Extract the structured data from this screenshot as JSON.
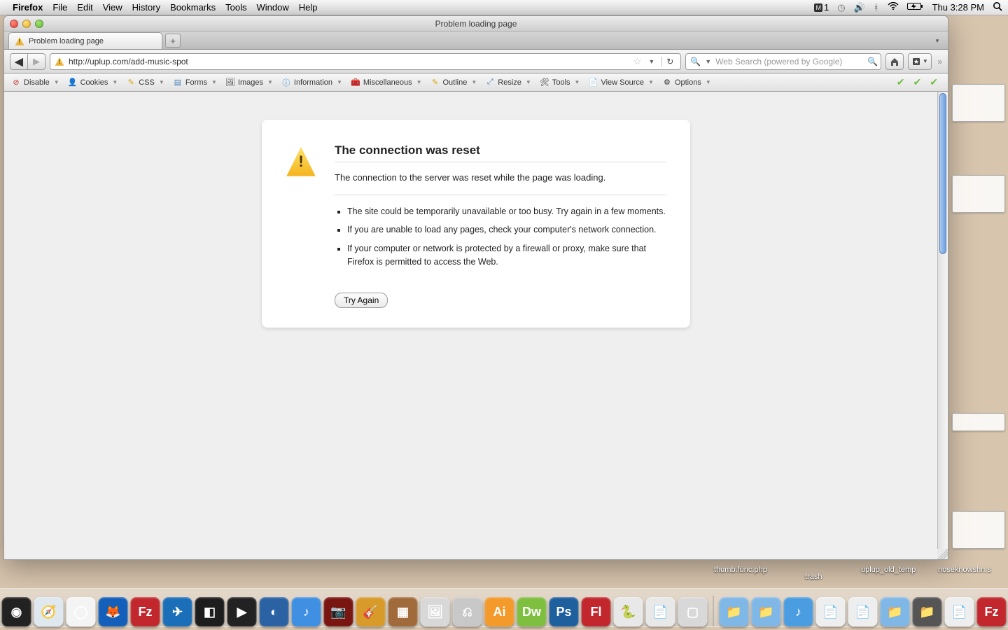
{
  "menubar": {
    "app": "Firefox",
    "items": [
      "File",
      "Edit",
      "View",
      "History",
      "Bookmarks",
      "Tools",
      "Window",
      "Help"
    ],
    "adobe_badge": "1",
    "clock": "Thu 3:28 PM"
  },
  "window": {
    "title": "Problem loading page"
  },
  "tab": {
    "title": "Problem loading page"
  },
  "address": {
    "url": "http://uplup.com/add-music-spot"
  },
  "search": {
    "placeholder": "Web Search (powered by Google)"
  },
  "devtoolbar": {
    "items": [
      "Disable",
      "Cookies",
      "CSS",
      "Forms",
      "Images",
      "Information",
      "Miscellaneous",
      "Outline",
      "Resize",
      "Tools",
      "View Source",
      "Options"
    ]
  },
  "error": {
    "heading": "The connection was reset",
    "message": "The connection to the server was reset while the page was loading.",
    "bullets": [
      "The site could be temporarily unavailable or too busy. Try again in a few moments.",
      "If you are unable to load any pages, check your computer's network connection.",
      "If your computer or network is protected by a firewall or proxy, make sure that Firefox is permitted to access the Web."
    ],
    "button": "Try Again"
  },
  "desktop": {
    "labels": [
      "thumb.func.php",
      "trash",
      "uplup_old_temp",
      "noseknowshn.s"
    ]
  },
  "dock": {
    "apps": [
      {
        "name": "finder",
        "bg": "#3aa3f2",
        "txt": "☺"
      },
      {
        "name": "dashboard",
        "bg": "#222",
        "txt": "◉"
      },
      {
        "name": "safari",
        "bg": "#dfe7ef",
        "txt": "🧭"
      },
      {
        "name": "chrome",
        "bg": "#f4f4f4",
        "txt": "◯"
      },
      {
        "name": "firefox",
        "bg": "#135fb9",
        "txt": "🦊"
      },
      {
        "name": "filezilla",
        "bg": "#c1272d",
        "txt": "Fz"
      },
      {
        "name": "tweetdeck",
        "bg": "#1b6fb8",
        "txt": "✈"
      },
      {
        "name": "app",
        "bg": "#1d1d1d",
        "txt": "◧"
      },
      {
        "name": "quicktime",
        "bg": "#222",
        "txt": "▶"
      },
      {
        "name": "app2",
        "bg": "#2a62a4",
        "txt": "◐"
      },
      {
        "name": "itunes",
        "bg": "#3f8fe2",
        "txt": "♪"
      },
      {
        "name": "photobooth",
        "bg": "#7a1611",
        "txt": "📷"
      },
      {
        "name": "garageband",
        "bg": "#d89b2a",
        "txt": "🎸"
      },
      {
        "name": "app3",
        "bg": "#a06a3a",
        "txt": "▦"
      },
      {
        "name": "preview",
        "bg": "#d8d8d8",
        "txt": "🖼"
      },
      {
        "name": "app4",
        "bg": "#c8c8c8",
        "txt": "⎌"
      },
      {
        "name": "illustrator",
        "bg": "#f39a2b",
        "txt": "Ai"
      },
      {
        "name": "dreamweaver",
        "bg": "#7fbf3f",
        "txt": "Dw"
      },
      {
        "name": "photoshop",
        "bg": "#1e5f9e",
        "txt": "Ps"
      },
      {
        "name": "flash",
        "bg": "#c1272d",
        "txt": "Fl"
      },
      {
        "name": "python",
        "bg": "#e8e8e8",
        "txt": "🐍"
      },
      {
        "name": "textedit",
        "bg": "#e8e8e8",
        "txt": "📄"
      },
      {
        "name": "terminal",
        "bg": "#d8d8d8",
        "txt": "▢"
      }
    ],
    "stacks": [
      {
        "name": "folder1",
        "bg": "#7fb7e6",
        "txt": "📁"
      },
      {
        "name": "folder2",
        "bg": "#7fb7e6",
        "txt": "📁"
      },
      {
        "name": "music",
        "bg": "#4a9de0",
        "txt": "♪"
      },
      {
        "name": "doc1",
        "bg": "#eee",
        "txt": "📄"
      },
      {
        "name": "doc2",
        "bg": "#eee",
        "txt": "📄"
      },
      {
        "name": "folder3",
        "bg": "#7fb7e6",
        "txt": "📁"
      },
      {
        "name": "folder4",
        "bg": "#555",
        "txt": "📁"
      },
      {
        "name": "doc3",
        "bg": "#eee",
        "txt": "📄"
      },
      {
        "name": "filezilla2",
        "bg": "#c1272d",
        "txt": "Fz"
      },
      {
        "name": "trash",
        "bg": "#bcbcbc",
        "txt": "🗑"
      }
    ]
  }
}
